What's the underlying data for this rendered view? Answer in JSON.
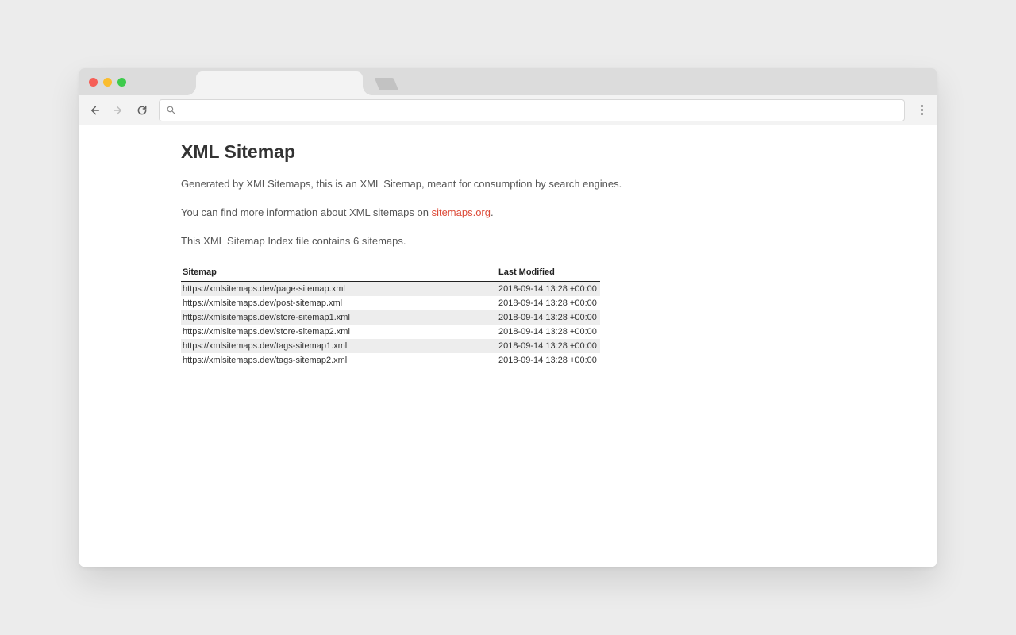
{
  "omnibox": {
    "value": "",
    "placeholder": ""
  },
  "page": {
    "heading": "XML Sitemap",
    "para1": "Generated by XMLSitemaps, this is an XML Sitemap, meant for consumption by search engines.",
    "para2_prefix": "You can find more information about XML sitemaps on ",
    "para2_link": "sitemaps.org",
    "para2_suffix": ".",
    "para3": "This XML Sitemap Index file contains 6 sitemaps.",
    "table": {
      "headers": {
        "sitemap": "Sitemap",
        "lastmod": "Last Modified"
      },
      "rows": [
        {
          "url": "https://xmlsitemaps.dev/page-sitemap.xml",
          "lastmod": "2018-09-14 13:28 +00:00"
        },
        {
          "url": "https://xmlsitemaps.dev/post-sitemap.xml",
          "lastmod": "2018-09-14 13:28 +00:00"
        },
        {
          "url": "https://xmlsitemaps.dev/store-sitemap1.xml",
          "lastmod": "2018-09-14 13:28 +00:00"
        },
        {
          "url": "https://xmlsitemaps.dev/store-sitemap2.xml",
          "lastmod": "2018-09-14 13:28 +00:00"
        },
        {
          "url": "https://xmlsitemaps.dev/tags-sitemap1.xml",
          "lastmod": "2018-09-14 13:28 +00:00"
        },
        {
          "url": "https://xmlsitemaps.dev/tags-sitemap2.xml",
          "lastmod": "2018-09-14 13:28 +00:00"
        }
      ]
    }
  }
}
